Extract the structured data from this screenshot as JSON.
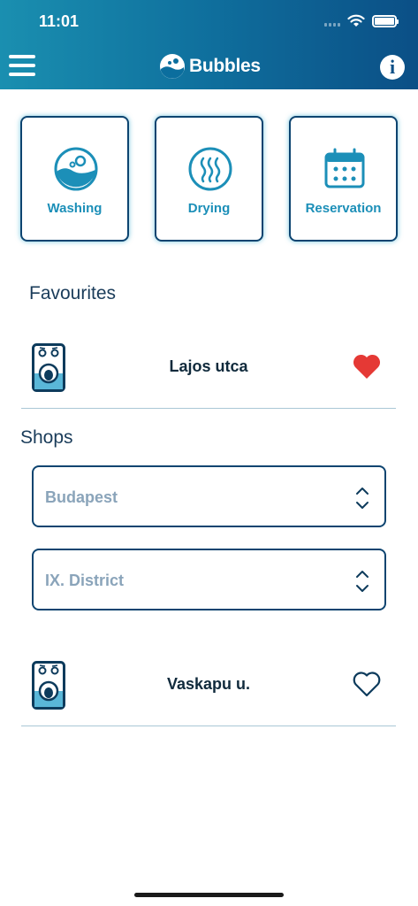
{
  "status_bar": {
    "time": "11:01"
  },
  "header": {
    "app_name": "Bubbles"
  },
  "tiles": [
    {
      "label": "Washing",
      "icon": "washing-icon"
    },
    {
      "label": "Drying",
      "icon": "drying-icon"
    },
    {
      "label": "Reservation",
      "icon": "calendar-icon"
    }
  ],
  "favourites": {
    "title": "Favourites",
    "items": [
      {
        "name": "Lajos utca",
        "favourite": true
      }
    ]
  },
  "shops": {
    "title": "Shops",
    "city_select": {
      "value": "Budapest"
    },
    "district_select": {
      "value": "IX. District"
    },
    "items": [
      {
        "name": "Vaskapu u.",
        "favourite": false
      }
    ]
  },
  "colors": {
    "header_start": "#1a8fb0",
    "header_end": "#0b4f86",
    "accent": "#1c8fb8",
    "heart": "#e53935"
  }
}
